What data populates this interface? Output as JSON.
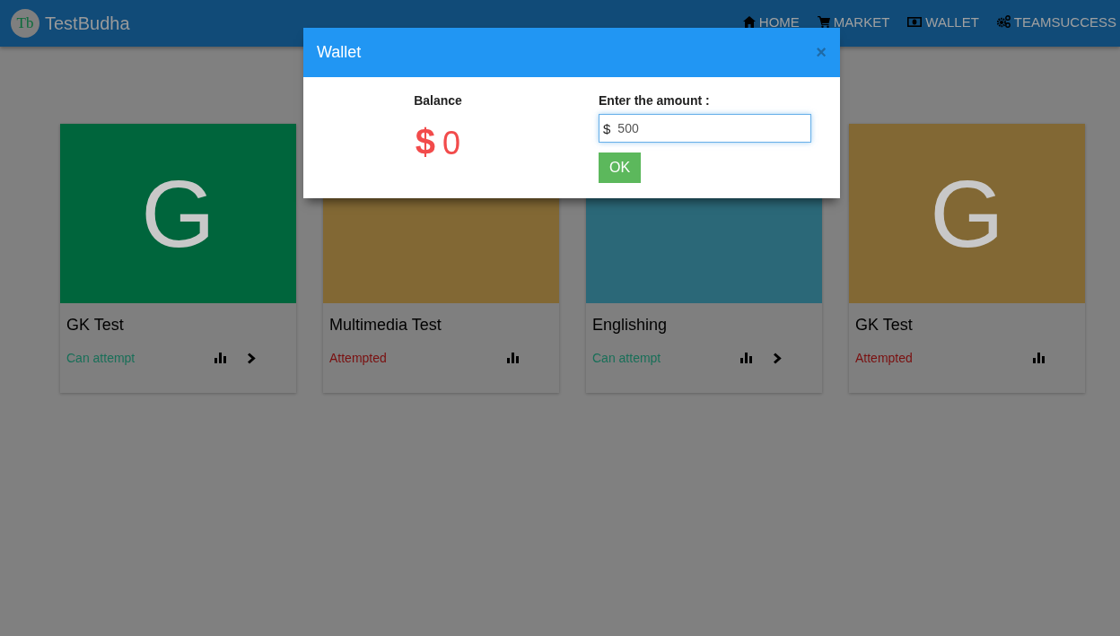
{
  "navbar": {
    "logo_mark": "Tb",
    "brand": "TestBudha",
    "links": [
      {
        "kind": "home",
        "label": "HOME"
      },
      {
        "kind": "market",
        "label": "MARKET"
      },
      {
        "kind": "wallet",
        "label": "WALLET"
      },
      {
        "kind": "team",
        "label": "TEAMSUCCESS"
      }
    ]
  },
  "cards": [
    {
      "letter": "G",
      "color": "#00653c",
      "title": "GK Test",
      "status": "Can attempt",
      "kind": "open"
    },
    {
      "color": "#826834",
      "title": "Multimedia Test",
      "status": "Attempted",
      "kind": "done"
    },
    {
      "color": "#2b6878",
      "title": "Englishing",
      "status": "Can attempt",
      "kind": "open"
    },
    {
      "letter": "G",
      "color": "#826834",
      "title": "GK Test",
      "status": "Attempted",
      "kind": "done"
    }
  ],
  "modal": {
    "title": "Wallet",
    "close": "×",
    "balance_label": "Balance",
    "balance_currency": "$",
    "balance_value": "0",
    "amount_label": "Enter the amount :",
    "amount_prefix": "$",
    "amount_value": "500",
    "ok_button": "OK"
  }
}
